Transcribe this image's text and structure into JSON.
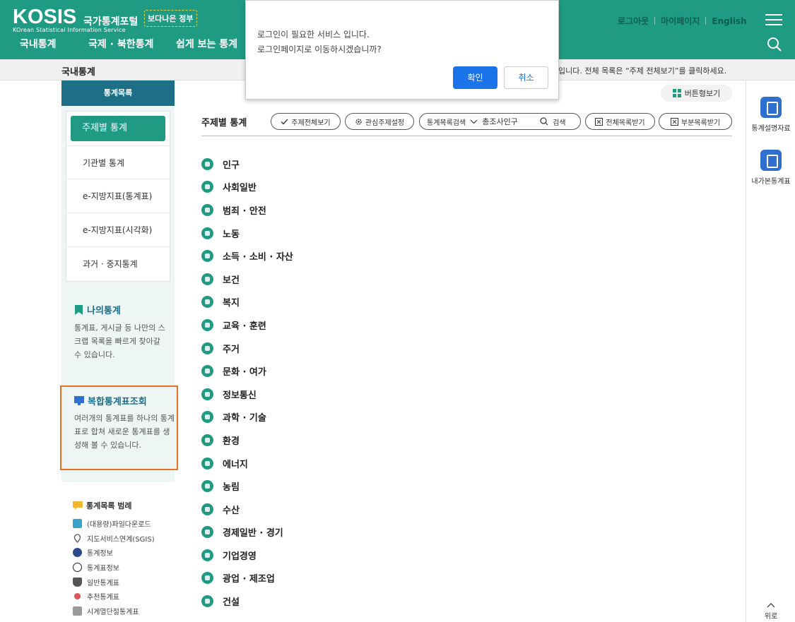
{
  "header": {
    "logo": "KOSIS",
    "portal": "국가통계포털",
    "logo_sub": "KOrean Statistical Information Service",
    "gov_badge": "보다나은 정부",
    "gnb": [
      "국내통계",
      "국제 · 북한통계",
      "쉽게 보는 통계"
    ],
    "util": [
      "로그아웃",
      "마이페이지",
      "English"
    ]
  },
  "breadcrumb": {
    "current": "국내통계",
    "notice": "입니다. 전체 목록은 “주제 전체보기”를 클릭하세요."
  },
  "lnb": {
    "title": "통계목록",
    "items": [
      "주제별 통계",
      "기관별 통계",
      "e-지방지표(통계표)",
      "e-지방지표(시각화)",
      "과거 · 중지통계"
    ],
    "my_title": "나의통계",
    "my_desc": "통계표, 게시글 등 나만의 스크랩 목록을 빠르게 찾아갈 수 있습니다.",
    "complex_title": "복합통계표조회",
    "complex_desc": "여러개의 통계표를 하나의 통계표로 합쳐 새로운 통계표를 생성해 볼 수 있습니다."
  },
  "legend": {
    "title": "통계목록 범례",
    "items": [
      "(대용량)파일다운로드",
      "지도서비스연계(SGIS)",
      "통계정보",
      "통계표정보",
      "일반통계표",
      "추천통계표",
      "시계열단절통계표"
    ]
  },
  "main": {
    "view_button": "버튼형보기",
    "title": "주제별 통계",
    "btn_all_topics": "주제전체보기",
    "btn_interest": "관심주제설정",
    "search_label": "통계목록검색",
    "search_value": "총조사인구",
    "search_button": "검색",
    "btn_full_list": "전체목록받기",
    "btn_partial_list": "부분목록받기",
    "topics": [
      "인구",
      "사회일반",
      "범죄 · 안전",
      "노동",
      "소득 · 소비 · 자산",
      "보건",
      "복지",
      "교육 · 훈련",
      "주거",
      "문화 · 여가",
      "정보통신",
      "과학 · 기술",
      "환경",
      "에너지",
      "농림",
      "수산",
      "경제일반 · 경기",
      "기업경영",
      "광업 · 제조업",
      "건설"
    ]
  },
  "quick": {
    "item1": "통계설명자료",
    "item2": "내가본통계표",
    "top": "위로"
  },
  "dialog": {
    "line1": "로그인이 필요한 서비스 입니다.",
    "line2": "로그인페이지로 이동하시겠습니까?",
    "ok": "확인",
    "cancel": "취소"
  },
  "colors": {
    "brand": "#1f9b84",
    "nav_head": "#1c6f87",
    "highlight": "#e8701e",
    "dialog_ok": "#1a73e8"
  }
}
